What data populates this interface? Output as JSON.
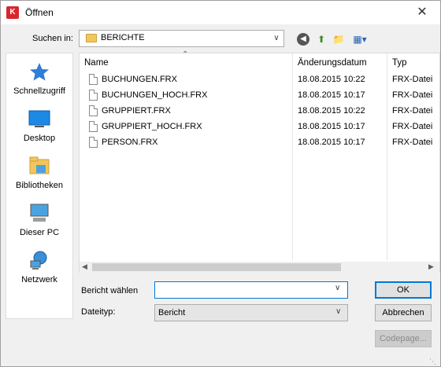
{
  "window": {
    "title": "Öffnen",
    "app_icon_text": "K",
    "close_glyph": "✕"
  },
  "toolbar": {
    "lookin_label": "Suchen in:",
    "lookin_value": "BERICHTE",
    "back_icon": "◀",
    "up_icon": "⬆",
    "newfolder_icon": "📁",
    "view_icon": "▦▾"
  },
  "places": [
    {
      "label": "Schnellzugriff",
      "icon": "star-icon"
    },
    {
      "label": "Desktop",
      "icon": "desktop-icon"
    },
    {
      "label": "Bibliotheken",
      "icon": "library-icon"
    },
    {
      "label": "Dieser PC",
      "icon": "computer-icon"
    },
    {
      "label": "Netzwerk",
      "icon": "network-icon"
    }
  ],
  "columns": {
    "name": "Name",
    "date": "Änderungsdatum",
    "type": "Typ"
  },
  "files": [
    {
      "name": "BUCHUNGEN.FRX",
      "date": "18.08.2015 10:22",
      "type": "FRX-Datei"
    },
    {
      "name": "BUCHUNGEN_HOCH.FRX",
      "date": "18.08.2015 10:17",
      "type": "FRX-Datei"
    },
    {
      "name": "GRUPPIERT.FRX",
      "date": "18.08.2015 10:22",
      "type": "FRX-Datei"
    },
    {
      "name": "GRUPPIERT_HOCH.FRX",
      "date": "18.08.2015 10:17",
      "type": "FRX-Datei"
    },
    {
      "name": "PERSON.FRX",
      "date": "18.08.2015 10:17",
      "type": "FRX-Datei"
    }
  ],
  "form": {
    "name_label": "Bericht wählen",
    "name_value": "",
    "type_label": "Dateityp:",
    "type_value": "Bericht"
  },
  "buttons": {
    "ok": "OK",
    "cancel": "Abbrechen",
    "codepage": "Codepage..."
  },
  "colors": {
    "accent": "#0078d7",
    "app_icon": "#d9262b"
  }
}
